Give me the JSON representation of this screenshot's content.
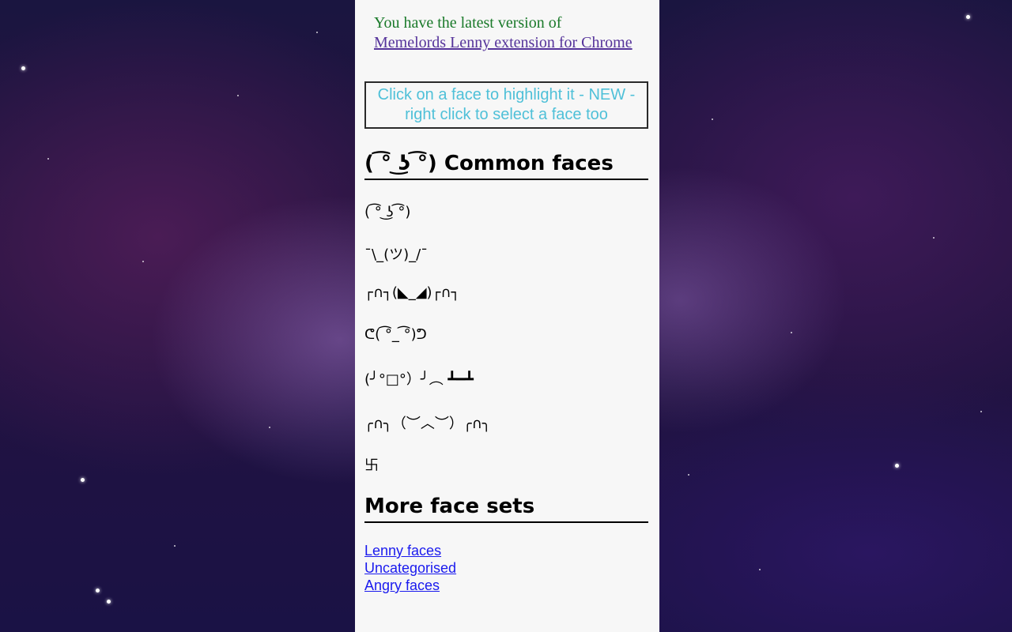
{
  "version_notice": {
    "text": "You have the latest version of",
    "link_label": "Memelords Lenny extension for Chrome"
  },
  "hint_box": {
    "text": "Click on a face to highlight it - NEW - right click to select a face too"
  },
  "common_faces": {
    "heading": "( ͡° ͜ʖ ͡°) Common faces",
    "items": [
      "( ͡° ͜ʖ ͡°)",
      "¯\\_(ツ)_/¯",
      "┌∩┐(◣_◢)┌∩┐",
      "ᕦ( ͡°_ ͡°)ᕤ",
      "(╯°□°）╯︵ ┻━┻",
      "╭∩╮（︶︿︶）╭∩╮",
      "卐"
    ]
  },
  "more_sets": {
    "heading": "More face sets",
    "links": [
      "Lenny faces",
      "Uncategorised",
      "Angry faces"
    ]
  }
}
